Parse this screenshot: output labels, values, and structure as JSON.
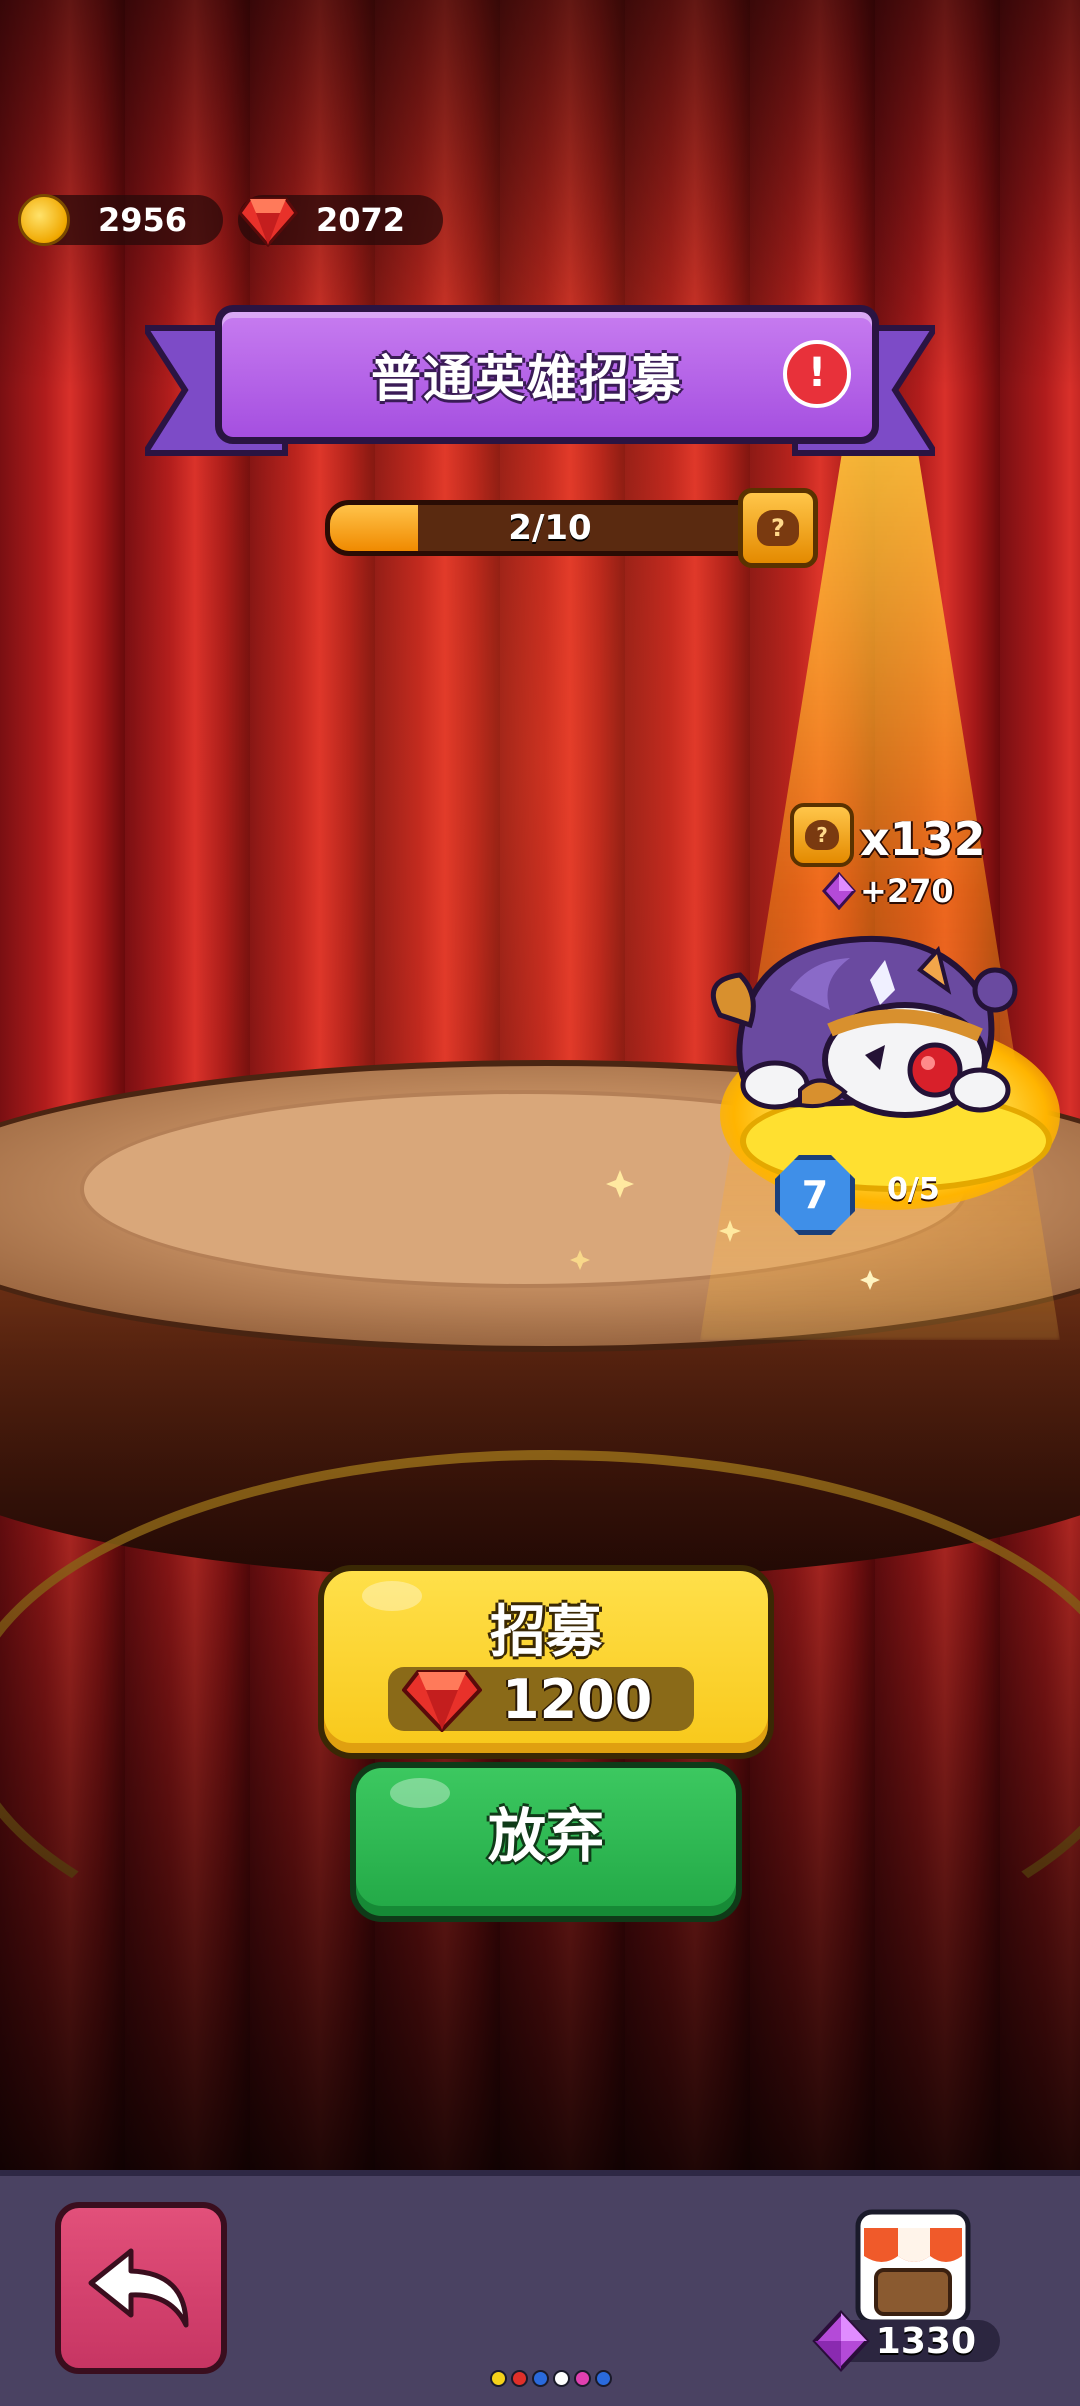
{
  "currency": {
    "coins": "2956",
    "gems": "2072"
  },
  "banner": {
    "title": "普通英雄招募",
    "alert_symbol": "!"
  },
  "progress": {
    "label": "2/10",
    "current": 2,
    "max": 10,
    "help_symbol": "?"
  },
  "hero": {
    "reward_count": "x132",
    "reward_symbol": "?",
    "gem_bonus": "+270",
    "level": "7",
    "shards": "0/5"
  },
  "buttons": {
    "recruit_label": "招募",
    "recruit_cost": "1200",
    "abandon_label": "放弃"
  },
  "bottom_bar": {
    "shop_gems": "1330",
    "page_dot_colors": [
      "#f5d21a",
      "#e0302a",
      "#2a6adc",
      "#ffffff",
      "#e040b0",
      "#2a6adc"
    ]
  },
  "colors": {
    "coin": "#f0a800",
    "gem_red": "#e8312a",
    "gem_purple": "#b44ad8",
    "banner": "#a54fe0",
    "recruit": "#f8c81a",
    "abandon": "#22a846",
    "back": "#c73563"
  }
}
